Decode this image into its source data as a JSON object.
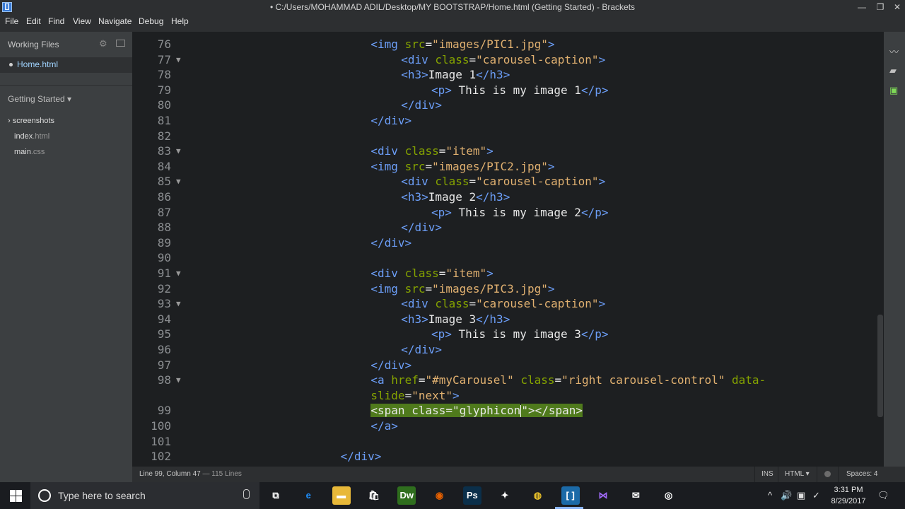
{
  "window": {
    "title": "• C:/Users/MOHAMMAD ADIL/Desktop/MY BOOTSTRAP/Home.html (Getting Started) - Brackets",
    "app_icon": "brackets-icon",
    "minimize": "—",
    "restore": "❐",
    "close": "✕"
  },
  "menu": [
    "File",
    "Edit",
    "Find",
    "View",
    "Navigate",
    "Debug",
    "Help"
  ],
  "sidebar": {
    "working_files_label": "Working Files",
    "open_file": "Home.html",
    "project_label": "Getting Started ▾",
    "tree": [
      {
        "name": "screenshots",
        "prefix": "› ",
        "ext": ""
      },
      {
        "name": "index",
        "prefix": "",
        "ext": ".html"
      },
      {
        "name": "main",
        "prefix": "",
        "ext": ".css"
      }
    ]
  },
  "editor": {
    "lines": [
      {
        "n": "76",
        "fold": "",
        "segs": [
          [
            "t",
            "<img "
          ],
          [
            "a",
            "src"
          ],
          [
            "x",
            "="
          ],
          [
            "s",
            "\"images/PIC1.jpg\""
          ],
          [
            "t",
            ">"
          ]
        ],
        "indent": "            "
      },
      {
        "n": "77",
        "fold": "▼",
        "segs": [
          [
            "t",
            "<div "
          ],
          [
            "a",
            "class"
          ],
          [
            "x",
            "="
          ],
          [
            "s",
            "\"carousel-caption\""
          ],
          [
            "t",
            ">"
          ]
        ],
        "indent": "                "
      },
      {
        "n": "78",
        "fold": "",
        "segs": [
          [
            "t",
            "<h3>"
          ],
          [
            "x",
            "Image 1"
          ],
          [
            "t",
            "</h3>"
          ]
        ],
        "indent": "                "
      },
      {
        "n": "79",
        "fold": "",
        "segs": [
          [
            "t",
            "<p>"
          ],
          [
            "x",
            " This is my image 1"
          ],
          [
            "t",
            "</p>"
          ]
        ],
        "indent": "                    "
      },
      {
        "n": "80",
        "fold": "",
        "segs": [
          [
            "t",
            "</div>"
          ]
        ],
        "indent": "                "
      },
      {
        "n": "81",
        "fold": "",
        "segs": [
          [
            "t",
            "</div>"
          ]
        ],
        "indent": "            "
      },
      {
        "n": "82",
        "fold": "",
        "segs": [],
        "indent": ""
      },
      {
        "n": "83",
        "fold": "▼",
        "segs": [
          [
            "t",
            "<div "
          ],
          [
            "a",
            "class"
          ],
          [
            "x",
            "="
          ],
          [
            "s",
            "\"item\""
          ],
          [
            "t",
            ">"
          ]
        ],
        "indent": "            "
      },
      {
        "n": "84",
        "fold": "",
        "segs": [
          [
            "t",
            "<img "
          ],
          [
            "a",
            "src"
          ],
          [
            "x",
            "="
          ],
          [
            "s",
            "\"images/PIC2.jpg\""
          ],
          [
            "t",
            ">"
          ]
        ],
        "indent": "            "
      },
      {
        "n": "85",
        "fold": "▼",
        "segs": [
          [
            "t",
            "<div "
          ],
          [
            "a",
            "class"
          ],
          [
            "x",
            "="
          ],
          [
            "s",
            "\"carousel-caption\""
          ],
          [
            "t",
            ">"
          ]
        ],
        "indent": "                "
      },
      {
        "n": "86",
        "fold": "",
        "segs": [
          [
            "t",
            "<h3>"
          ],
          [
            "x",
            "Image 2"
          ],
          [
            "t",
            "</h3>"
          ]
        ],
        "indent": "                "
      },
      {
        "n": "87",
        "fold": "",
        "segs": [
          [
            "t",
            "<p>"
          ],
          [
            "x",
            " This is my image 2"
          ],
          [
            "t",
            "</p>"
          ]
        ],
        "indent": "                    "
      },
      {
        "n": "88",
        "fold": "",
        "segs": [
          [
            "t",
            "</div>"
          ]
        ],
        "indent": "                "
      },
      {
        "n": "89",
        "fold": "",
        "segs": [
          [
            "t",
            "</div>"
          ]
        ],
        "indent": "            "
      },
      {
        "n": "90",
        "fold": "",
        "segs": [],
        "indent": ""
      },
      {
        "n": "91",
        "fold": "▼",
        "segs": [
          [
            "t",
            "<div "
          ],
          [
            "a",
            "class"
          ],
          [
            "x",
            "="
          ],
          [
            "s",
            "\"item\""
          ],
          [
            "t",
            ">"
          ]
        ],
        "indent": "            "
      },
      {
        "n": "92",
        "fold": "",
        "segs": [
          [
            "t",
            "<img "
          ],
          [
            "a",
            "src"
          ],
          [
            "x",
            "="
          ],
          [
            "s",
            "\"images/PIC3.jpg\""
          ],
          [
            "t",
            ">"
          ]
        ],
        "indent": "            "
      },
      {
        "n": "93",
        "fold": "▼",
        "segs": [
          [
            "t",
            "<div "
          ],
          [
            "a",
            "class"
          ],
          [
            "x",
            "="
          ],
          [
            "s",
            "\"carousel-caption\""
          ],
          [
            "t",
            ">"
          ]
        ],
        "indent": "                "
      },
      {
        "n": "94",
        "fold": "",
        "segs": [
          [
            "t",
            "<h3>"
          ],
          [
            "x",
            "Image 3"
          ],
          [
            "t",
            "</h3>"
          ]
        ],
        "indent": "                "
      },
      {
        "n": "95",
        "fold": "",
        "segs": [
          [
            "t",
            "<p>"
          ],
          [
            "x",
            " This is my image 3"
          ],
          [
            "t",
            "</p>"
          ]
        ],
        "indent": "                    "
      },
      {
        "n": "96",
        "fold": "",
        "segs": [
          [
            "t",
            "</div>"
          ]
        ],
        "indent": "                "
      },
      {
        "n": "97",
        "fold": "",
        "segs": [
          [
            "t",
            "</div>"
          ]
        ],
        "indent": "            "
      },
      {
        "n": "98",
        "fold": "▼",
        "segs": [
          [
            "t",
            "<a "
          ],
          [
            "a",
            "href"
          ],
          [
            "x",
            "="
          ],
          [
            "s",
            "\"#myCarousel\""
          ],
          [
            "x",
            " "
          ],
          [
            "a",
            "class"
          ],
          [
            "x",
            "="
          ],
          [
            "s",
            "\"right carousel-control\""
          ],
          [
            "x",
            " "
          ],
          [
            "a",
            "data-"
          ]
        ],
        "indent": "            "
      },
      {
        "n": "",
        "fold": "",
        "segs": [
          [
            "a",
            "slide"
          ],
          [
            "x",
            "="
          ],
          [
            "s",
            "\"next\""
          ],
          [
            "t",
            ">"
          ]
        ],
        "indent": "            "
      },
      {
        "n": "99",
        "fold": "",
        "segs": [
          [
            "hl",
            "<span class=\"glyphicon"
          ],
          [
            "cursor",
            ""
          ],
          [
            "hl",
            "\"></span>"
          ]
        ],
        "indent": "            "
      },
      {
        "n": "100",
        "fold": "",
        "segs": [
          [
            "t",
            "</a>"
          ]
        ],
        "indent": "            "
      },
      {
        "n": "101",
        "fold": "",
        "segs": [],
        "indent": ""
      },
      {
        "n": "102",
        "fold": "",
        "segs": [
          [
            "t",
            "</div>"
          ]
        ],
        "indent": "        "
      }
    ]
  },
  "status": {
    "position": "Line 99, Column 47",
    "lines": " — 115 Lines",
    "mode": "INS",
    "language": "HTML ▾",
    "spaces": "Spaces: 4"
  },
  "taskbar": {
    "search_placeholder": "Type here to search",
    "apps": [
      {
        "icon": "task-view-icon",
        "label": "⧉",
        "bg": "transparent"
      },
      {
        "icon": "edge-icon",
        "label": "e",
        "bg": "transparent",
        "color": "#1e90ff"
      },
      {
        "icon": "file-explorer-icon",
        "label": "▬",
        "bg": "#e8b839"
      },
      {
        "icon": "store-icon",
        "label": "🛍",
        "bg": "transparent"
      },
      {
        "icon": "dreamweaver-icon",
        "label": "Dw",
        "bg": "#2f6e1e"
      },
      {
        "icon": "firefox-icon",
        "label": "◉",
        "bg": "transparent",
        "color": "#e66000"
      },
      {
        "icon": "photoshop-icon",
        "label": "Ps",
        "bg": "#0b2f4a"
      },
      {
        "icon": "cc-icon",
        "label": "✦",
        "bg": "transparent"
      },
      {
        "icon": "chrome-icon",
        "label": "◍",
        "bg": "transparent",
        "color": "#e8c02a"
      },
      {
        "icon": "brackets-icon",
        "label": "[ ]",
        "bg": "#1b6aa8"
      },
      {
        "icon": "visual-studio-icon",
        "label": "⋈",
        "bg": "transparent",
        "color": "#a46cff"
      },
      {
        "icon": "mail-icon",
        "label": "✉",
        "bg": "transparent"
      },
      {
        "icon": "obs-icon",
        "label": "◎",
        "bg": "transparent"
      }
    ],
    "tray": [
      "^",
      "🔊",
      "▣",
      "✓",
      "⌨"
    ],
    "time": "3:31 PM",
    "date": "8/29/2017"
  }
}
